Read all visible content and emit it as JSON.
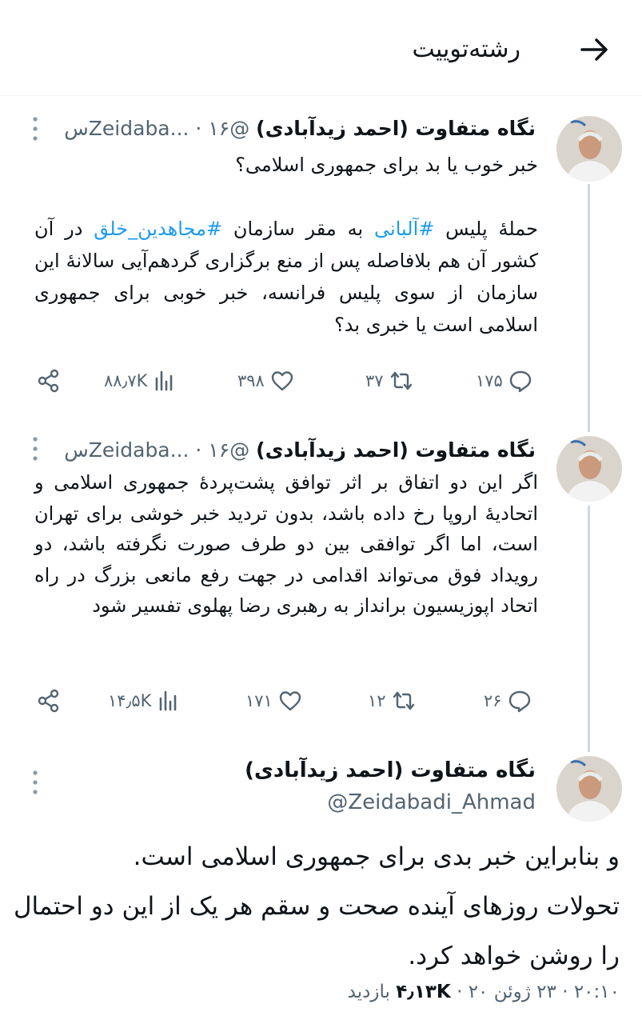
{
  "header": {
    "title": "رشته‌توییت",
    "back_icon": "arrow-right-icon"
  },
  "tweets": [
    {
      "name": "نگاه متفاوت (احمد زیدآبادی)",
      "handle": "@Zeidaba...",
      "time": "۱۶س",
      "separator": "·",
      "line1": "خبر خوب یا بد برای جمهوری اسلامی؟",
      "p2_before": "حملهٔ پلیس ",
      "p2_tag1": "#آلبانی",
      "p2_mid": " به مقر سازمان ",
      "p2_tag2": "#مجاهدین_خلق",
      "p2_after": " در آن کشور آن هم  بلافاصله پس از منع برگزاری گردهم‌آیی سالانهٔ این سازمان از سوی پلیس فرانسه، خبر خوبی برای جمهوری اسلامی است یا خبری بد؟",
      "replies": "۱۷۵",
      "retweets": "۳۷",
      "likes": "۳۹۸",
      "views": "۸۸٫۷K"
    },
    {
      "name": "نگاه متفاوت (احمد زیدآبادی)",
      "handle": "@Zeidaba...",
      "time": "۱۶س",
      "separator": "·",
      "text": "اگر این دو اتفاق بر اثر توافق پشت‌پردهٔ جمهوری اسلامی و اتحادیهٔ اروپا رخ داده باشد، بدون تردید خبر خوشی برای تهران است، اما اگر توافقی بین دو طرف صورت نگرفته باشد، دو رویداد فوق می‌تواند اقدامی در جهت رفع مانعی بزرگ در راه اتحاد اپوزیسیون برانداز به رهبری رضا پهلوی تفسیر شود",
      "replies": "۲۶",
      "retweets": "۱۲",
      "likes": "۱۷۱",
      "views": "۱۴٫۵K"
    }
  ],
  "main_tweet": {
    "name": "نگاه متفاوت (احمد زیدآبادی)",
    "handle": "@Zeidabadi_Ahmad",
    "line1": "و بنابراین خبر بدی برای جمهوری اسلامی است.",
    "line2": "تحولات روزهای آینده صحت و سقم هر یک از این دو احتمال را روشن خواهد کرد.",
    "time": "۲۰:۱۰",
    "date": "۲۳ ژوئن ۲۰",
    "views_count": "۱۳K",
    "views_prefix": "۴",
    "views_label": "بازدید",
    "separator": "·"
  },
  "colors": {
    "accent": "#1d9bf0",
    "secondary_text": "#536471",
    "thread_line": "#cfd9de"
  }
}
